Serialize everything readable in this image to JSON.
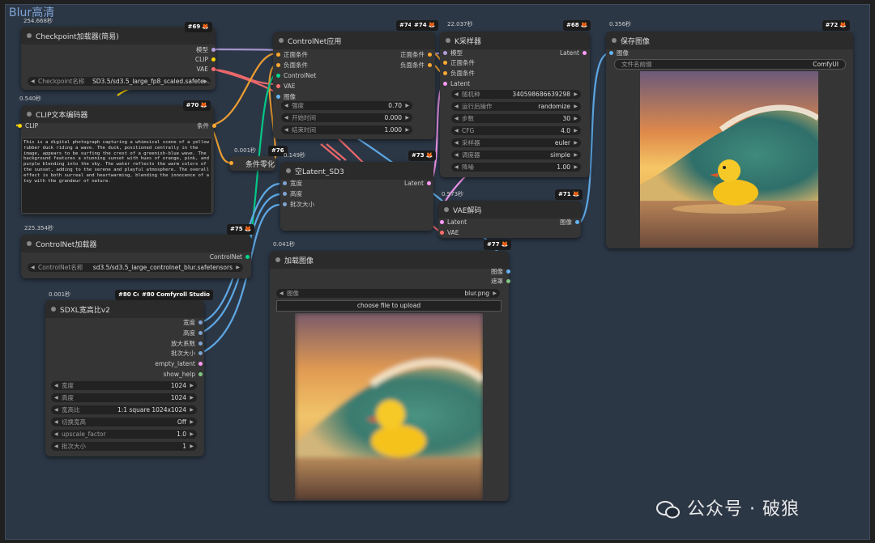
{
  "group": {
    "title": "Blur高清"
  },
  "colors": {
    "model": "#b39ddb",
    "clip": "#ffd500",
    "vae": "#ff6e6e",
    "conditioning": "#ffa931",
    "latent": "#ff9cf9",
    "image": "#64b5f6",
    "controlnet": "#00d78d",
    "int": "#7fa4d4",
    "mask": "#81c784"
  },
  "nodes": {
    "checkpoint": {
      "badge": "#69",
      "time": "254.668秒",
      "title": "Checkpoint加载器(简易)",
      "outputs": [
        "模型",
        "CLIP",
        "VAE"
      ],
      "widget": {
        "label": "Checkpoint名称",
        "value": "SD3.5/sd3.5_large_fp8_scaled.safete..."
      }
    },
    "clip_text": {
      "badge": "#70",
      "time": "0.540秒",
      "title": "CLIP文本编码器",
      "input": "CLIP",
      "output": "条件",
      "text": "This is a digital photograph capturing a whimsical scene of a yellow rubber duck riding a wave. The duck, positioned centrally in the image, appears to be surfing the crest of a greenish-blue wave. The background features a stunning sunset with hues of orange, pink, and purple blending into the sky. The water reflects the warm colors of the sunset, adding to the serene and playful atmosphere. The overall effect is both surreal and heartwarming, blending the innocence of a toy with the grandeur of nature."
    },
    "controlnet_apply": {
      "badge1": "#74",
      "badge2": "#74",
      "title": "ControlNet应用",
      "inputs": [
        "正面条件",
        "负面条件",
        "ControlNet",
        "VAE",
        "图像"
      ],
      "outputs": [
        "正面条件",
        "负面条件"
      ],
      "widgets": [
        {
          "label": "强度",
          "value": "0.70"
        },
        {
          "label": "开始时间",
          "value": "0.000"
        },
        {
          "label": "结束时间",
          "value": "1.000"
        }
      ]
    },
    "ksampler": {
      "badge": "#68",
      "time": "22.037秒",
      "title": "K采样器",
      "inputs": [
        "模型",
        "正面条件",
        "负面条件",
        "Latent"
      ],
      "output": "Latent",
      "widgets": [
        {
          "label": "随机种",
          "value": "340598686639298"
        },
        {
          "label": "运行后操作",
          "value": "randomize"
        },
        {
          "label": "步数",
          "value": "30"
        },
        {
          "label": "CFG",
          "value": "4.0"
        },
        {
          "label": "采样器",
          "value": "euler"
        },
        {
          "label": "调度器",
          "value": "simple"
        },
        {
          "label": "降噪",
          "value": "1.00"
        }
      ]
    },
    "save": {
      "badge": "#72",
      "time": "0.356秒",
      "title": "保存图像",
      "input": "图像",
      "widget": {
        "label": "文件名前缀",
        "value": "ComfyUI"
      }
    },
    "cond_zero": {
      "badge": "#76",
      "time": "0.001秒",
      "title": "条件零化"
    },
    "empty_latent": {
      "badge": "#73",
      "time": "0.149秒",
      "title": "空Latent_SD3",
      "inputs": [
        "宽度",
        "高度",
        "批次大小"
      ],
      "output": "Latent"
    },
    "vae_decode": {
      "badge": "#71",
      "time": "0.573秒",
      "title": "VAE解码",
      "inputs": [
        "Latent",
        "VAE"
      ],
      "output": "图像"
    },
    "controlnet_loader": {
      "badge": "#75",
      "time": "225.354秒",
      "title": "ControlNet加载器",
      "output": "ControlNet",
      "widget": {
        "label": "ControlNet名称",
        "value": "sd3.5/sd3.5_large_controlnet_blur.safetensors"
      }
    },
    "load_image": {
      "badge": "#77",
      "time": "0.041秒",
      "title": "加载图像",
      "outputs": [
        "图像",
        "遮罩"
      ],
      "widget": {
        "label": "图像",
        "value": "blur.png"
      },
      "upload": "choose file to upload"
    },
    "sdxl": {
      "badge1": "#80 Cor",
      "badge2": "#80 Comfyroll Studio",
      "time": "0.001秒",
      "title": "SDXL宽高比v2",
      "outputs": [
        "宽度",
        "高度",
        "放大系数",
        "批次大小",
        "empty_latent",
        "show_help"
      ],
      "widgets": [
        {
          "label": "宽度",
          "value": "1024"
        },
        {
          "label": "高度",
          "value": "1024"
        },
        {
          "label": "宽高比",
          "value": "1:1 square 1024x1024"
        },
        {
          "label": "切换宽高",
          "value": "Off"
        },
        {
          "label": "upscale_factor",
          "value": "1.0"
        },
        {
          "label": "批次大小",
          "value": "1"
        }
      ]
    }
  },
  "watermark": {
    "text": "公众号 · 破狼"
  }
}
